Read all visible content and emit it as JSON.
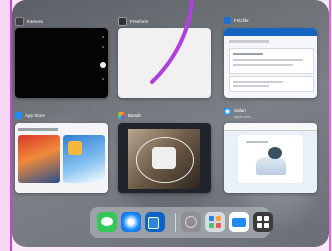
{
  "apps": [
    {
      "name": "Kamera",
      "icon": "camera-icon"
    },
    {
      "name": "Freeform",
      "icon": "freeform-icon"
    },
    {
      "name": "Fritzlife",
      "icon": "fritzlife-icon"
    },
    {
      "name": "App Store",
      "icon": "app-store-icon"
    },
    {
      "name": "Bandit",
      "icon": "photos-icon"
    },
    {
      "name": "Safari",
      "subtitle": "apple.com",
      "icon": "safari-icon"
    }
  ],
  "dock": {
    "icons": [
      "messages-icon",
      "safari-icon",
      "outlook-icon",
      "settings-icon",
      "app-library-icon",
      "files-icon",
      "app-switcher-icon"
    ]
  },
  "colors": {
    "annotation": "#b23fe0",
    "device_bezel": "#5d6166"
  }
}
